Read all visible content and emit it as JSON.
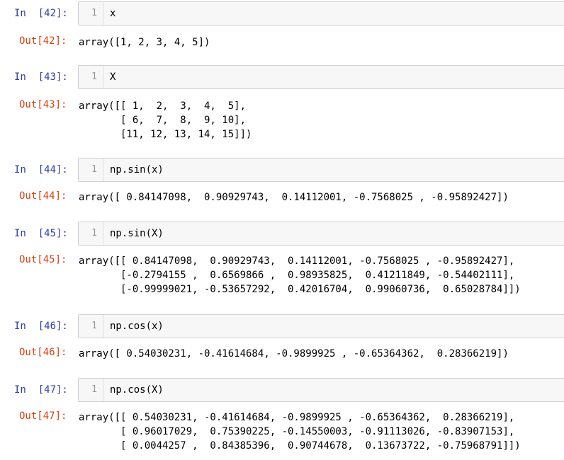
{
  "cells": [
    {
      "in_prompt": "In  [42]:",
      "line_number": "1",
      "code": "x",
      "out_prompt": "Out[42]:",
      "output": "array([1, 2, 3, 4, 5])"
    },
    {
      "in_prompt": "In  [43]:",
      "line_number": "1",
      "code": "X",
      "out_prompt": "Out[43]:",
      "output": "array([[ 1,  2,  3,  4,  5],\n       [ 6,  7,  8,  9, 10],\n       [11, 12, 13, 14, 15]])"
    },
    {
      "in_prompt": "In  [44]:",
      "line_number": "1",
      "code": "np.sin(x)",
      "out_prompt": "Out[44]:",
      "output": "array([ 0.84147098,  0.90929743,  0.14112001, -0.7568025 , -0.95892427])"
    },
    {
      "in_prompt": "In  [45]:",
      "line_number": "1",
      "code": "np.sin(X)",
      "out_prompt": "Out[45]:",
      "output": "array([[ 0.84147098,  0.90929743,  0.14112001, -0.7568025 , -0.95892427],\n       [-0.2794155 ,  0.6569866 ,  0.98935825,  0.41211849, -0.54402111],\n       [-0.99999021, -0.53657292,  0.42016704,  0.99060736,  0.65028784]])"
    },
    {
      "in_prompt": "In  [46]:",
      "line_number": "1",
      "code": "np.cos(x)",
      "out_prompt": "Out[46]:",
      "output": "array([ 0.54030231, -0.41614684, -0.9899925 , -0.65364362,  0.28366219])"
    },
    {
      "in_prompt": "In  [47]:",
      "line_number": "1",
      "code": "np.cos(X)",
      "out_prompt": "Out[47]:",
      "output": "array([[ 0.54030231, -0.41614684, -0.9899925 , -0.65364362,  0.28366219],\n       [ 0.96017029,  0.75390225, -0.14550003, -0.91113026, -0.83907153],\n       [ 0.0044257 ,  0.84385396,  0.90744678,  0.13673722, -0.75968791]])"
    }
  ]
}
